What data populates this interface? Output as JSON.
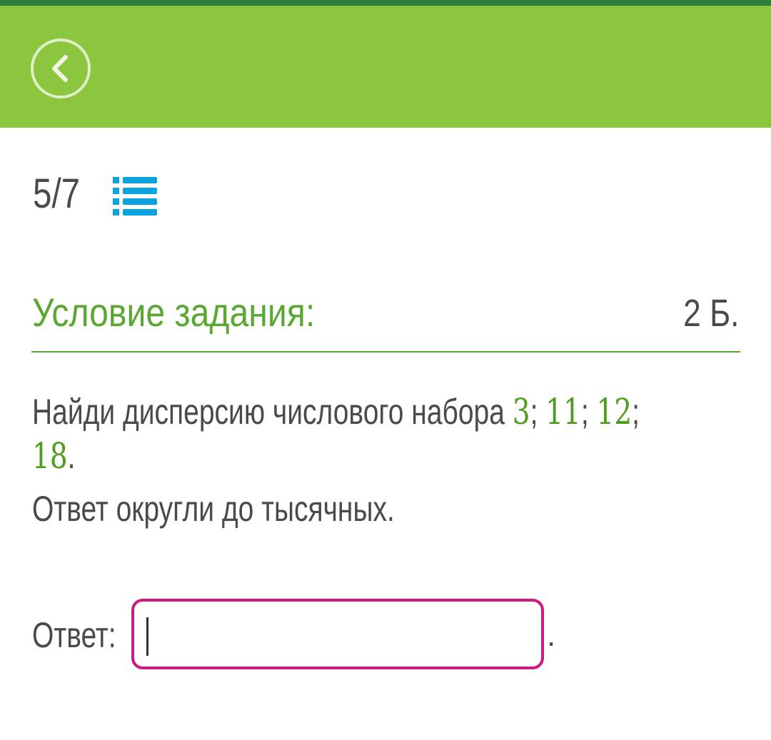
{
  "header": {
    "back_icon": "chevron-left-icon",
    "colors": {
      "bar": "#8cc63f",
      "strip": "#2f7d3c"
    }
  },
  "progress": {
    "current": "5",
    "separator": "/",
    "total": "7",
    "list_icon": "list-icon"
  },
  "task": {
    "title": "Условие задания:",
    "points": "2 Б.",
    "question_text": "Найди дисперсию числового набора ",
    "numbers": [
      "3",
      "11",
      "12",
      "18"
    ],
    "separator": "; ",
    "end_punct": ".",
    "instruction": "Ответ округли до тысячных."
  },
  "answer": {
    "label": "Ответ:",
    "value": "",
    "suffix": ".",
    "border_color": "#d01882"
  }
}
